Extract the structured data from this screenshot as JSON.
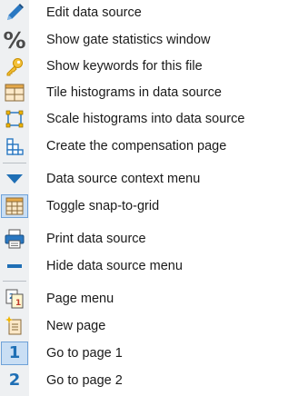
{
  "menu": {
    "groups": [
      {
        "items": [
          {
            "label": "Edit data source",
            "icon": "pencil-icon"
          },
          {
            "label": "Show gate statistics window",
            "icon": "percent-icon"
          },
          {
            "label": "Show keywords for this file",
            "icon": "key-icon"
          },
          {
            "label": "Tile histograms in data source",
            "icon": "tile-icon"
          },
          {
            "label": "Scale histograms into data source",
            "icon": "scale-icon"
          },
          {
            "label": "Create the compensation page",
            "icon": "compensation-icon"
          }
        ]
      },
      {
        "items": [
          {
            "label": "Data source context menu",
            "icon": "triangle-down-icon"
          },
          {
            "label": "Toggle snap-to-grid",
            "icon": "grid-icon",
            "selected": true
          },
          {
            "label": "Print data source",
            "icon": "printer-icon"
          },
          {
            "label": "Hide data source menu",
            "icon": "minus-icon"
          }
        ]
      },
      {
        "items": [
          {
            "label": "Page menu",
            "icon": "pages-icon"
          },
          {
            "label": "New page",
            "icon": "new-page-icon"
          },
          {
            "label": "Go to page 1",
            "icon": "page-1-icon",
            "icon_text": "1",
            "selected": true
          },
          {
            "label": "Go to page 2",
            "icon": "page-2-icon",
            "icon_text": "2"
          }
        ]
      }
    ]
  },
  "colors": {
    "icon_bar": "#eef0f2",
    "accent_blue": "#1f6fb5",
    "selected_bg": "#c9def4",
    "selected_border": "#6ea1d8",
    "key_yellow": "#f0b400"
  }
}
